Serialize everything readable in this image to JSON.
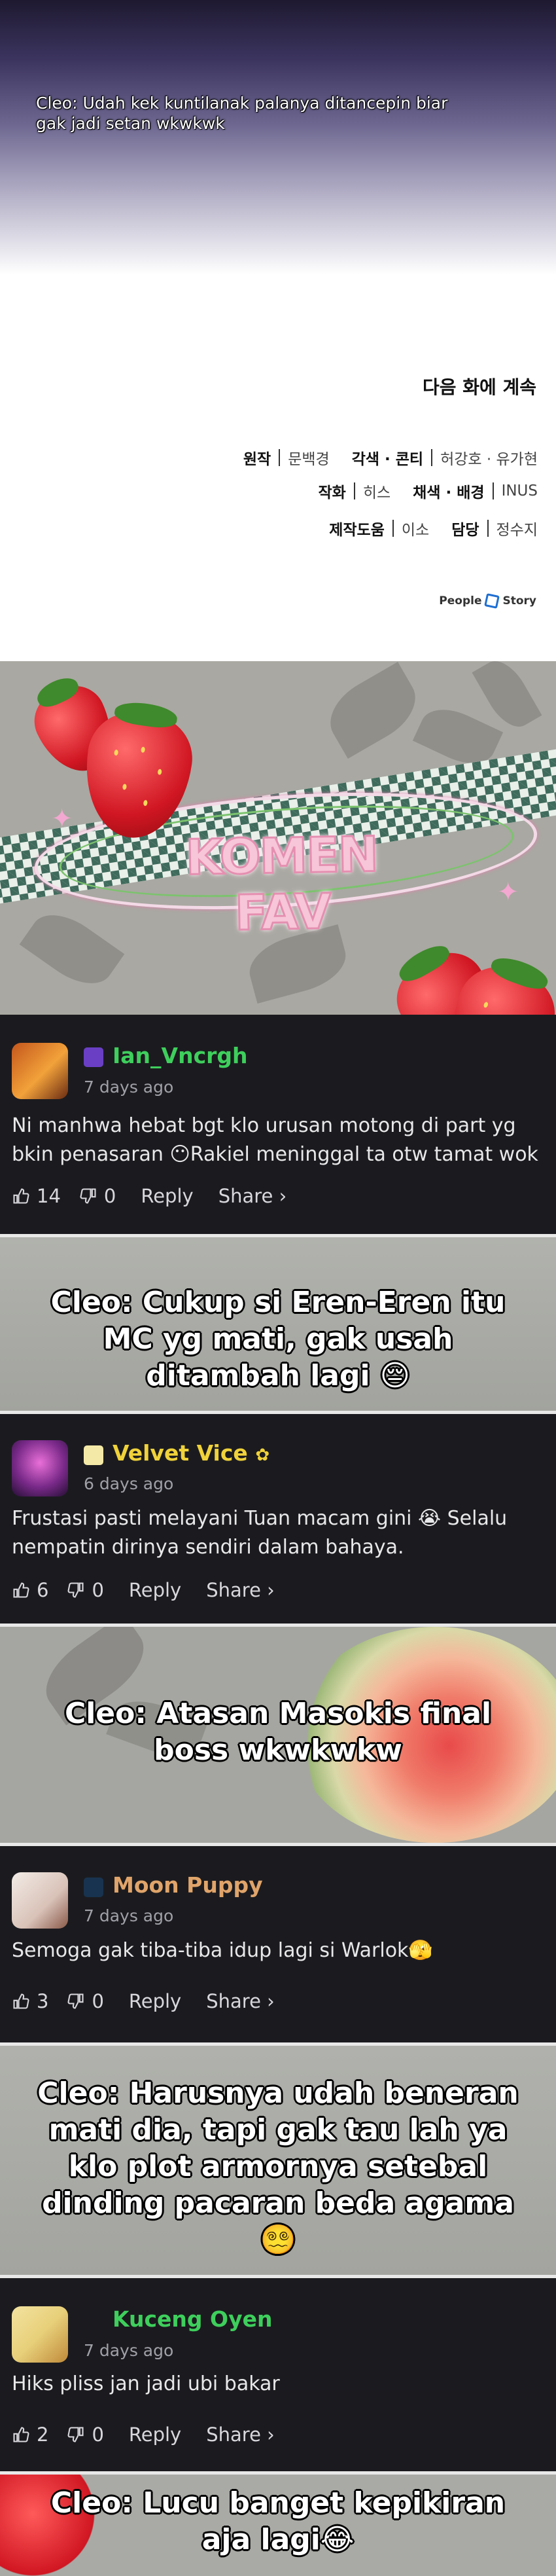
{
  "top": {
    "caption": "Cleo: Udah kek kuntilanak palanya ditancepin biar gak jadi setan wkwkwk",
    "continue_text": "다음 화에 계속",
    "credits": [
      {
        "k1": "원작",
        "v1": "문백경",
        "k2": "각색 · 콘티",
        "v2": "허강호 · 유가현"
      },
      {
        "k1": "작화",
        "v1": "히스",
        "k2": "채색 · 배경",
        "v2": "INUS"
      },
      {
        "k1": "제작도움",
        "v1": "이소",
        "k2": "담당",
        "v2": "정수지"
      }
    ],
    "logo_left": "People",
    "logo_right": "Story"
  },
  "banner": {
    "title": "KOMEN FAV"
  },
  "comments": [
    {
      "username": "Ian_Vncrgh",
      "name_color": "#3ecf5c",
      "time": "7 days ago",
      "text": "Ni manhwa hebat bgt klo urusan motong di part yg bkin penasaran 😶Rakiel meninggal ta otw tamat wok",
      "likes": "14",
      "dislikes": "0",
      "reply": "Reply",
      "share": "Share ›",
      "badge_color": "#6a3fc4",
      "avatar_colors": [
        "#c4561c",
        "#f2a23a"
      ]
    },
    {
      "username": "Velvet Vice",
      "name_color": "#f0d23a",
      "name_suffix": "✿",
      "time": "6 days ago",
      "text": "Frustasi pasti melayani Tuan macam gini 😭 Selalu nempatin dirinya sendiri dalam bahaya.",
      "likes": "6",
      "dislikes": "0",
      "reply": "Reply",
      "share": "Share ›",
      "badge_color": "#f5e9a8",
      "avatar_colors": [
        "#3a1e5a",
        "#c25ab8"
      ]
    },
    {
      "username": "Moon Puppy",
      "name_color": "#e0a46a",
      "time": "7 days ago",
      "text": "Semoga gak tiba-tiba idup lagi si Warlok🫣",
      "likes": "3",
      "dislikes": "0",
      "reply": "Reply",
      "share": "Share ›",
      "badge_color": "#18334f",
      "avatar_colors": [
        "#f2ece6",
        "#d9c2b8"
      ]
    },
    {
      "username": "Kuceng Oyen",
      "name_color": "#3ecf5c",
      "time": "7 days ago",
      "text": "Hiks pliss jan jadi ubi bakar",
      "likes": "2",
      "dislikes": "0",
      "reply": "Reply",
      "share": "Share ›",
      "badge_color": "#1b1b1f",
      "avatar_colors": [
        "#e8d07a",
        "#c08a3a"
      ]
    }
  ],
  "captions": [
    "Cleo: Cukup si Eren-Eren itu MC yg mati, gak usah ditambah lagi 😔",
    "Cleo: Atasan Masokis final boss wkwkwkw",
    "Cleo: Harusnya udah beneran mati dia, tapi gak tau lah ya klo plot armornya setebal dinding pacaran beda agama 😵‍💫",
    "Cleo: Lucu banget kepikiran aja lagi😂"
  ],
  "colors": {
    "dark_bg": "#1b1b1f",
    "panel_gray": "#a9aaa5",
    "accent_pink": "#f2a8d0"
  },
  "icons": [
    "thumb-up-icon",
    "thumb-down-icon"
  ]
}
